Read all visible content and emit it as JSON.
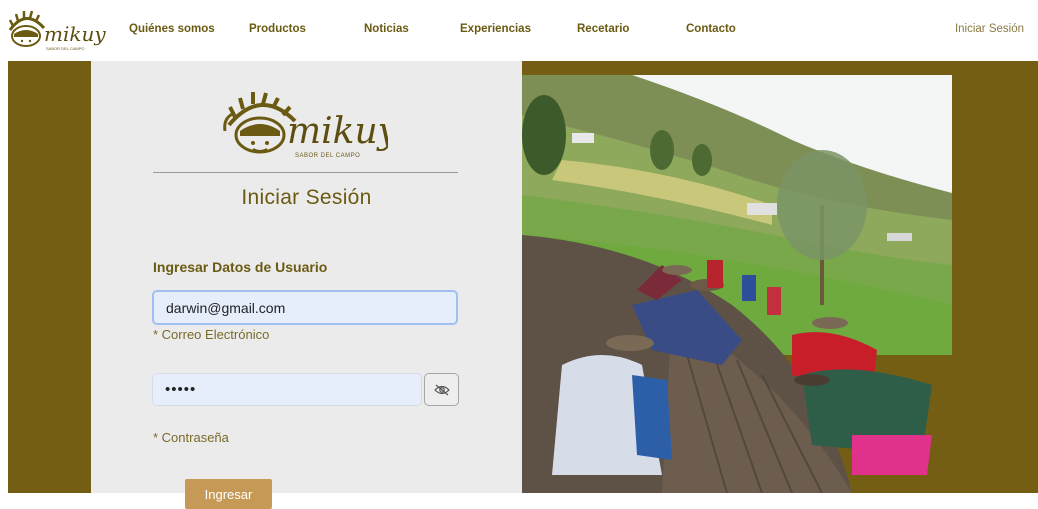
{
  "brand": {
    "name": "mikuy",
    "tagline": "SABOR DEL CAMPO"
  },
  "nav": {
    "links": [
      {
        "label": "Quiénes somos"
      },
      {
        "label": "Productos"
      },
      {
        "label": "Noticias"
      },
      {
        "label": "Experiencias"
      },
      {
        "label": "Recetario"
      },
      {
        "label": "Contacto"
      }
    ],
    "login": "Iniciar Sesión"
  },
  "login": {
    "title": "Iniciar Sesión",
    "section_label": "Ingresar Datos de Usuario",
    "email_value": "darwin@gmail.com",
    "email_help": "* Correo Electrónico",
    "password_value": "•••••",
    "password_help": "* Contraseña",
    "toggle_icon": "eye-slash-icon",
    "submit_label": "Ingresar"
  },
  "colors": {
    "brand_olive": "#735e14",
    "nav_text": "#6b5a12",
    "panel_bg": "#ebebeb",
    "button": "#c69a56",
    "input_bg": "#e6eefb"
  }
}
